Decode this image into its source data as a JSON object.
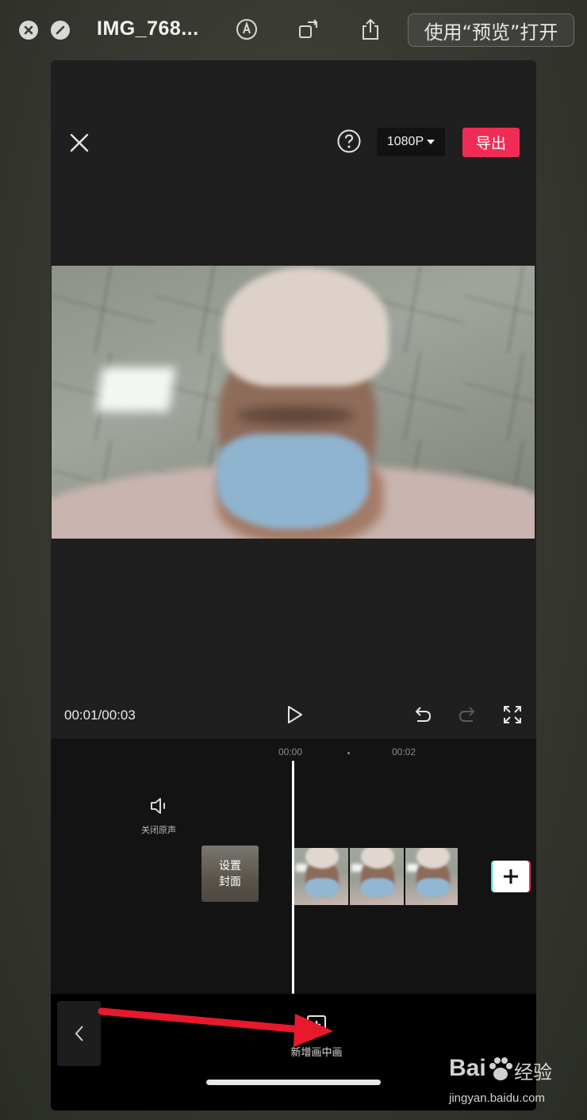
{
  "window": {
    "title": "IMG_768...",
    "open_with_label": "使用“预览”打开"
  },
  "editor": {
    "resolution": "1080P",
    "export_label": "导出",
    "timecode": "00:01/00:03",
    "timeline": {
      "ticks": [
        "00:00",
        "00:02"
      ],
      "mute_label": "关闭原声",
      "cover_label_line1": "设置",
      "cover_label_line2": "封面",
      "clip_count": 3
    },
    "toolbar": {
      "pip_label": "新增画中画"
    }
  },
  "watermark": {
    "brand": "Bai",
    "brand_suffix": "经验",
    "url": "jingyan.baidu.com"
  },
  "colors": {
    "export": "#f02c56",
    "annotation_arrow": "#e8192c",
    "accent_cyan": "#3ee0e8"
  }
}
